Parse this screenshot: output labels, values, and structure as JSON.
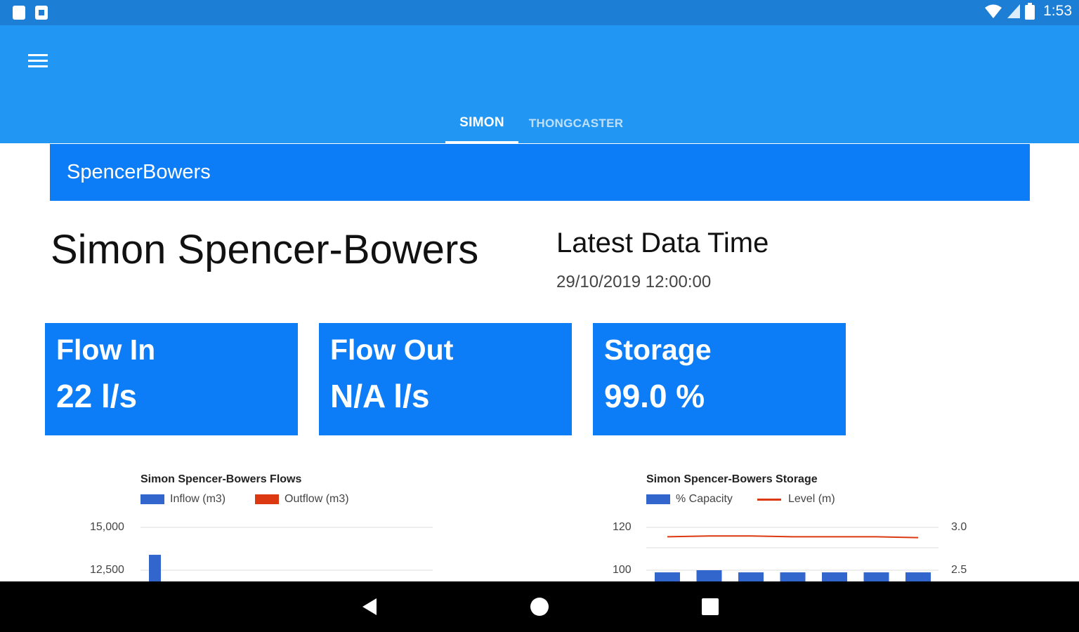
{
  "status_bar": {
    "time": "1:53",
    "icons": [
      "sd-card-icon",
      "notification-icon",
      "wifi-icon",
      "signal-icon",
      "battery-icon"
    ]
  },
  "app_bar": {
    "menu_icon": "hamburger-menu-icon",
    "tabs": [
      {
        "label": "SIMON",
        "active": true
      },
      {
        "label": "THONGCASTER",
        "active": false
      }
    ]
  },
  "site": {
    "name": "SpencerBowers"
  },
  "page": {
    "title": "Simon Spencer-Bowers",
    "latest_label": "Latest Data Time",
    "latest_value": "29/10/2019 12:00:00"
  },
  "cards": [
    {
      "title": "Flow In",
      "value": "22 l/s"
    },
    {
      "title": "Flow Out",
      "value": "N/A l/s"
    },
    {
      "title": "Storage",
      "value": "99.0 %"
    }
  ],
  "colors": {
    "accent": "#2196f3",
    "banner": "#0d7cf7",
    "inflow": "#3366cc",
    "outflow": "#dc3912"
  },
  "chart_data": [
    {
      "type": "bar",
      "title": "Simon Spencer-Bowers Flows",
      "legend": [
        "Inflow (m3)",
        "Outflow (m3)"
      ],
      "legend_position": "top-left",
      "y_ticks": [
        "15,000",
        "12,500"
      ],
      "ylim_visible": [
        12000,
        15000
      ],
      "series": [
        {
          "name": "Inflow (m3)",
          "values": [
            13400
          ]
        },
        {
          "name": "Outflow (m3)",
          "values": []
        }
      ],
      "grid": true
    },
    {
      "type": "bar",
      "title": "Simon Spencer-Bowers Storage",
      "legend": [
        "% Capacity",
        "Level (m)"
      ],
      "legend_position": "top-left",
      "y_ticks_left": [
        "120",
        "100"
      ],
      "y_ticks_right": [
        "3.0",
        "2.5"
      ],
      "ylim_left_visible": [
        95,
        120
      ],
      "ylim_right_visible": [
        2.4,
        3.0
      ],
      "series": [
        {
          "name": "% Capacity",
          "values": [
            99,
            100,
            99,
            99,
            99,
            99,
            99
          ]
        },
        {
          "name": "Level (m)",
          "values": [
            2.89,
            2.9,
            2.9,
            2.89,
            2.89,
            2.89,
            2.88
          ]
        }
      ],
      "grid": true
    }
  ]
}
